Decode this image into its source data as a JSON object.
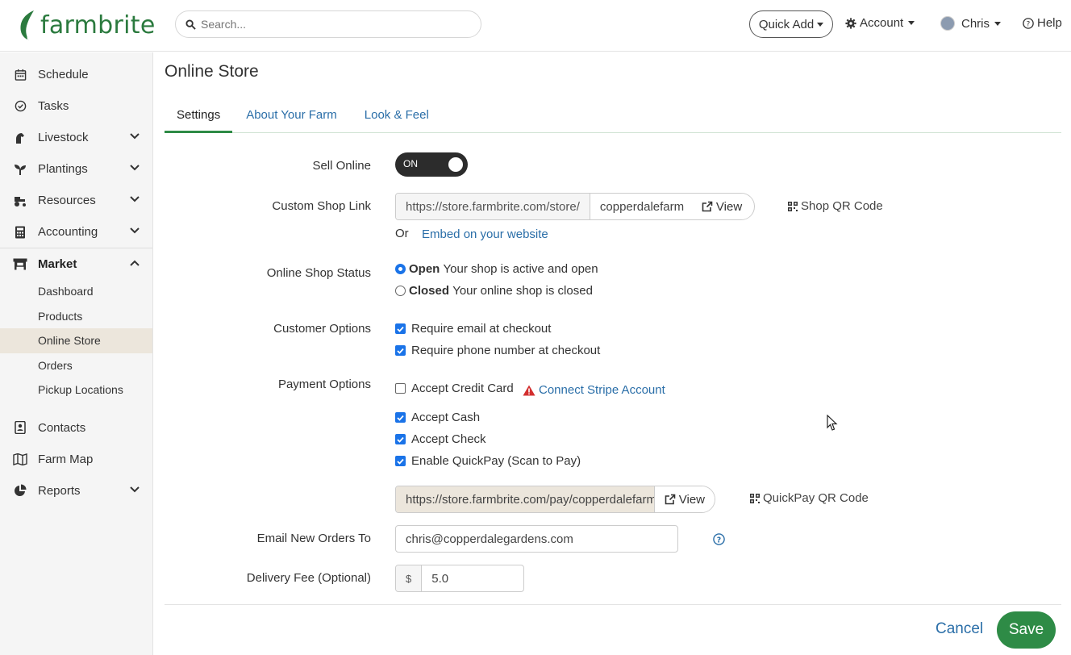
{
  "brand": {
    "name": "farmbrite",
    "color": "#2b7a3e"
  },
  "search": {
    "placeholder": "Search..."
  },
  "header": {
    "quick_add": "Quick Add",
    "account": "Account",
    "user": "Chris",
    "help": "Help"
  },
  "sidebar": {
    "items": [
      {
        "label": "Schedule",
        "icon": "calendar-icon"
      },
      {
        "label": "Tasks",
        "icon": "check-circle-icon"
      },
      {
        "label": "Livestock",
        "icon": "horse-icon"
      },
      {
        "label": "Plantings",
        "icon": "seedling-icon"
      },
      {
        "label": "Resources",
        "icon": "tractor-icon"
      },
      {
        "label": "Accounting",
        "icon": "calculator-icon"
      },
      {
        "label": "Market",
        "icon": "store-icon"
      },
      {
        "label": "Contacts",
        "icon": "address-book-icon"
      },
      {
        "label": "Farm Map",
        "icon": "map-icon"
      },
      {
        "label": "Reports",
        "icon": "pie-chart-icon"
      }
    ],
    "market_sub": [
      "Dashboard",
      "Products",
      "Online Store",
      "Orders",
      "Pickup Locations"
    ],
    "active_sub": "Online Store"
  },
  "page": {
    "title": "Online Store",
    "tabs": [
      "Settings",
      "About Your Farm",
      "Look & Feel"
    ]
  },
  "form": {
    "sell_online": {
      "label": "Sell Online",
      "value": "ON"
    },
    "shop_link": {
      "label": "Custom Shop Link",
      "prefix": "https://store.farmbrite.com/store/",
      "value": "copperdalefarm",
      "view": "View",
      "qr": "Shop QR Code",
      "or": "Or",
      "embed": "Embed on your website"
    },
    "status": {
      "label": "Online Shop Status",
      "open_title": "Open",
      "open_desc": "Your shop is active and open",
      "closed_title": "Closed",
      "closed_desc": "Your online shop is closed",
      "selected": "Open"
    },
    "customer": {
      "label": "Customer Options",
      "email": "Require email at checkout",
      "phone": "Require phone number at checkout"
    },
    "payment": {
      "label": "Payment Options",
      "credit": "Accept Credit Card",
      "stripe": "Connect Stripe Account",
      "cash": "Accept Cash",
      "check": "Accept Check",
      "quickpay": "Enable QuickPay (Scan to Pay)",
      "quickpay_url": "https://store.farmbrite.com/pay/copperdalefarm",
      "view": "View",
      "qr": "QuickPay QR Code"
    },
    "email_orders": {
      "label": "Email New Orders To",
      "value": "chris@copperdalegardens.com"
    },
    "delivery": {
      "label": "Delivery Fee (Optional)",
      "currency": "$",
      "value": "5.0"
    }
  },
  "footer": {
    "cancel": "Cancel",
    "save": "Save"
  },
  "colors": {
    "accent": "#2e8b46",
    "link": "#2a6ea8",
    "checkbox": "#1a73e8",
    "warning": "#d32f2f"
  }
}
